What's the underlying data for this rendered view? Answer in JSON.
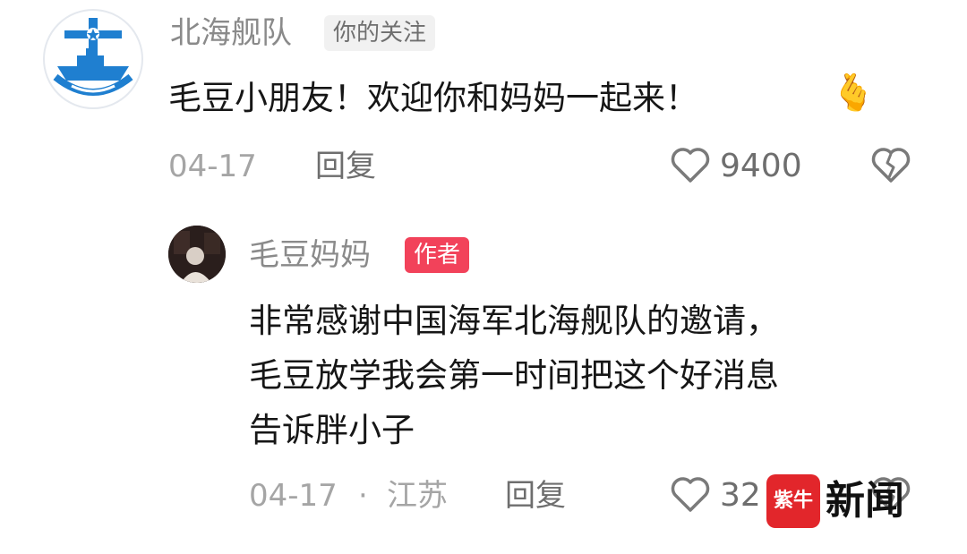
{
  "top_comment": {
    "author": "北海舰队",
    "follow_tag": "你的关注",
    "text": "毛豆小朋友！欢迎你和妈妈一起来！",
    "emoji": "🫰",
    "date": "04-17",
    "reply_label": "回复",
    "like_count": "9400"
  },
  "reply_comment": {
    "author": "毛豆妈妈",
    "author_tag": "作者",
    "text_lines": [
      "非常感谢中国海军北海舰队的邀请，",
      "毛豆放学我会第一时间把这个好消息",
      "告诉胖小子"
    ],
    "date": "04-17",
    "location": "江苏",
    "separator": "·",
    "reply_label": "回复",
    "like_count": "32"
  },
  "watermark": {
    "logo_text": "紫牛",
    "text": "新闻"
  },
  "colors": {
    "author_tag_bg": "#f2425a",
    "navy_blue": "#1f7fd0",
    "watermark_red": "#e2262b"
  }
}
